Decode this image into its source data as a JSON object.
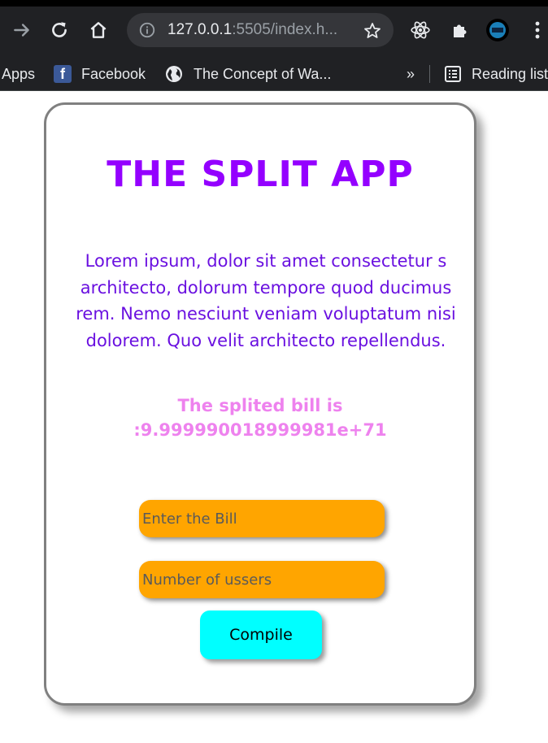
{
  "browser": {
    "url_host": "127.0.0.1",
    "url_rest": ":5505/index.h...",
    "icons": [
      "forward-icon",
      "reload-icon",
      "home-icon",
      "info-icon",
      "star-icon",
      "react-extension-icon",
      "extensions-puzzle-icon",
      "profile-avatar-icon",
      "menu-dots-icon"
    ],
    "bookmarks": [
      {
        "label": "Apps",
        "icon": "apps-grid-icon"
      },
      {
        "label": "Facebook",
        "icon": "facebook-icon"
      },
      {
        "label": "The Concept of Wa...",
        "icon": "globe-icon"
      }
    ],
    "overflow_label": "»",
    "reading_list_label": "Reading list"
  },
  "page": {
    "title": "THE SPLIT APP",
    "description_lines": [
      "Lorem ipsum, dolor sit amet consectetur s",
      "architecto, dolorum tempore quod ducimus",
      "rem. Nemo nesciunt veniam voluptatum nisi",
      "dolorem. Quo velit architecto repellendus."
    ],
    "result_lines": [
      "The splited bill is",
      ":9.999990018999981e+71"
    ],
    "bill_input": {
      "placeholder": "Enter the Bill",
      "value": ""
    },
    "users_input": {
      "placeholder": "Number of ussers",
      "value": ""
    },
    "compile_label": "Compile",
    "colors": {
      "title": "#9400ff",
      "description": "#6a10e0",
      "result": "#ee82ee",
      "input_bg": "#ffa500",
      "button_bg": "#00ffff"
    }
  }
}
